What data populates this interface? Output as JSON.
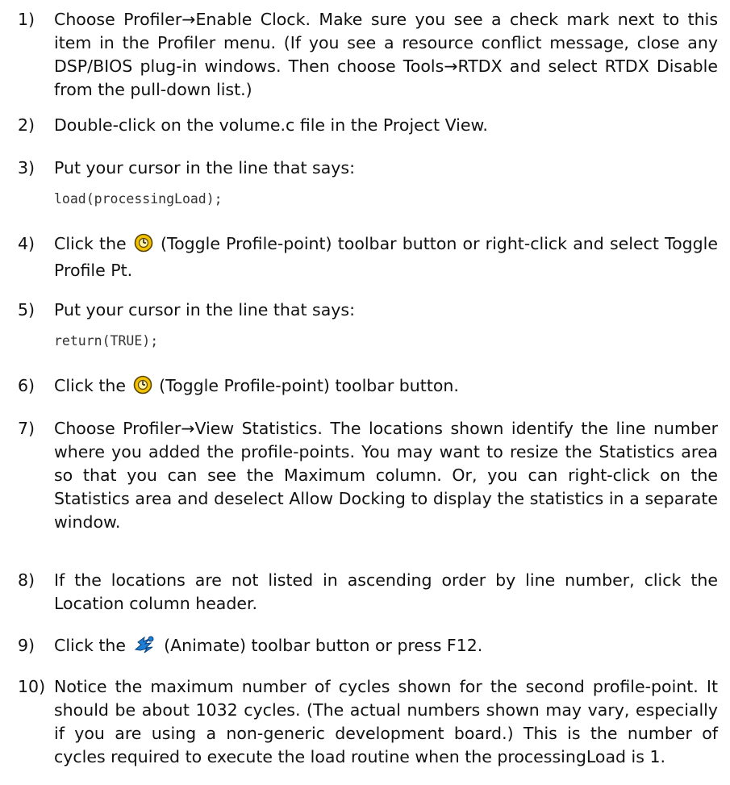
{
  "steps": [
    {
      "number": "1)",
      "parts": [
        "Choose Profiler",
        "→",
        "Enable Clock. Make sure you see a check mark next to this item in the Profiler menu. (If you see a resource conflict message, close any DSP/BIOS plug-in windows. Then choose Tools",
        "→",
        "RTDX and select RTDX Disable from the pull-down list.)"
      ]
    },
    {
      "number": "2)",
      "text": "Double-click on the volume.c file in the Project View."
    },
    {
      "number": "3)",
      "text": "Put your cursor in the line that says:",
      "code": "load(processingLoad);"
    },
    {
      "number": "4)",
      "before_icon": "Click the",
      "icon": "toggle-profile-point-icon",
      "after_icon": "(Toggle Profile-point) toolbar button or right-click and select Toggle Profile Pt."
    },
    {
      "number": "5)",
      "text": "Put your cursor in the line that says:",
      "code": "return(TRUE);"
    },
    {
      "number": "6)",
      "before_icon": "Click the",
      "icon": "toggle-profile-point-icon",
      "after_icon": "(Toggle Profile-point) toolbar button."
    },
    {
      "number": "7)",
      "parts": [
        "Choose Profiler",
        "→",
        "View Statistics. The locations shown identify the line number where you added the profile-points. You may want to resize the Statistics area so that you can see the Maximum column. Or, you can right-click on the Statistics area and deselect Allow Docking to display the statistics in a separate window."
      ]
    },
    {
      "number": "8)",
      "text": "If the locations are not listed in ascending order by line number, click the Location column header."
    },
    {
      "number": "9)",
      "before_icon": "Click the",
      "icon": "animate-icon",
      "after_icon": "(Animate) toolbar button or press F12."
    },
    {
      "number": "10)",
      "text": "Notice the maximum number of cycles shown for the second profile-point. It should be about 1032 cycles. (The actual numbers shown may vary, especially if you are using a non-generic development board.) This is the number of cycles required to execute the load routine when the processingLoad is 1."
    }
  ],
  "colors": {
    "text": "#111111",
    "code_text": "#333333",
    "profile_icon_fill": "#f2c200",
    "animate_icon_fill": "#1e7fd6"
  }
}
